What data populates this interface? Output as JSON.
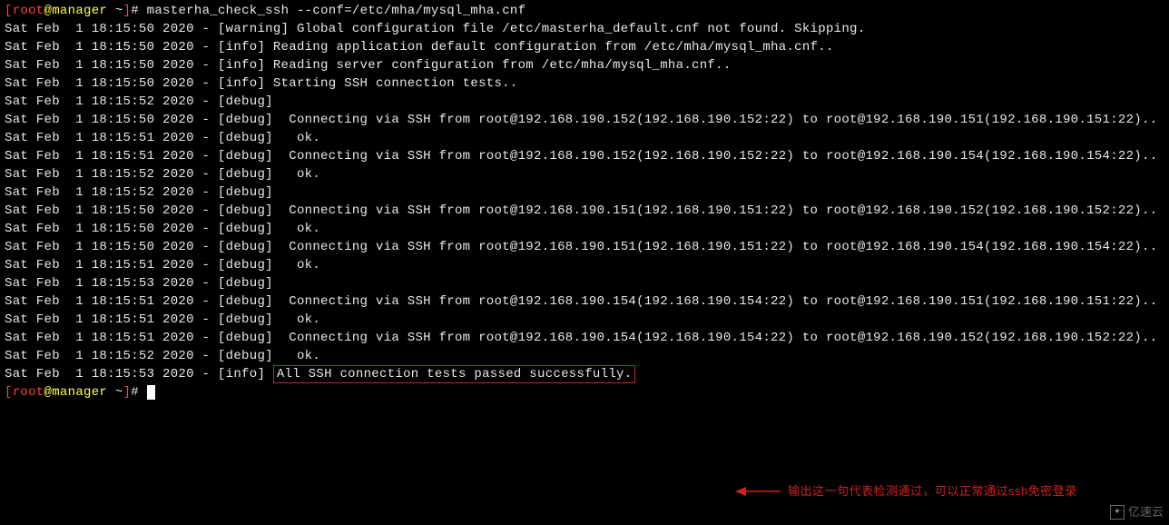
{
  "prompt1": {
    "bracket_open": "[",
    "user": "root",
    "at": "@",
    "host": "manager",
    "path": " ~",
    "bracket_close": "]",
    "hash": "# ",
    "cmd": "masterha_check_ssh --conf=/etc/mha/mysql_mha.cnf"
  },
  "lines": [
    "Sat Feb  1 18:15:50 2020 - [warning] Global configuration file /etc/masterha_default.cnf not found. Skipping.",
    "Sat Feb  1 18:15:50 2020 - [info] Reading application default configuration from /etc/mha/mysql_mha.cnf..",
    "Sat Feb  1 18:15:50 2020 - [info] Reading server configuration from /etc/mha/mysql_mha.cnf..",
    "Sat Feb  1 18:15:50 2020 - [info] Starting SSH connection tests..",
    "Sat Feb  1 18:15:52 2020 - [debug] ",
    "Sat Feb  1 18:15:50 2020 - [debug]  Connecting via SSH from root@192.168.190.152(192.168.190.152:22) to root@192.168.190.151(192.168.190.151:22)..",
    "Sat Feb  1 18:15:51 2020 - [debug]   ok.",
    "Sat Feb  1 18:15:51 2020 - [debug]  Connecting via SSH from root@192.168.190.152(192.168.190.152:22) to root@192.168.190.154(192.168.190.154:22)..",
    "Sat Feb  1 18:15:52 2020 - [debug]   ok.",
    "Sat Feb  1 18:15:52 2020 - [debug] ",
    "Sat Feb  1 18:15:50 2020 - [debug]  Connecting via SSH from root@192.168.190.151(192.168.190.151:22) to root@192.168.190.152(192.168.190.152:22)..",
    "Sat Feb  1 18:15:50 2020 - [debug]   ok.",
    "Sat Feb  1 18:15:50 2020 - [debug]  Connecting via SSH from root@192.168.190.151(192.168.190.151:22) to root@192.168.190.154(192.168.190.154:22)..",
    "Sat Feb  1 18:15:51 2020 - [debug]   ok.",
    "Sat Feb  1 18:15:53 2020 - [debug] ",
    "Sat Feb  1 18:15:51 2020 - [debug]  Connecting via SSH from root@192.168.190.154(192.168.190.154:22) to root@192.168.190.151(192.168.190.151:22)..",
    "Sat Feb  1 18:15:51 2020 - [debug]   ok.",
    "Sat Feb  1 18:15:51 2020 - [debug]  Connecting via SSH from root@192.168.190.154(192.168.190.154:22) to root@192.168.190.152(192.168.190.152:22)..",
    "Sat Feb  1 18:15:52 2020 - [debug]   ok."
  ],
  "final_line_prefix": "Sat Feb  1 18:15:53 2020 - [info] ",
  "final_line_boxed": "All SSH connection tests passed successfully.",
  "prompt2": {
    "bracket_open": "[",
    "user": "root",
    "at": "@",
    "host": "manager",
    "path": " ~",
    "bracket_close": "]",
    "hash": "# "
  },
  "annotation": "输出这一句代表检测通过，可以正常通过ssh免密登录",
  "watermark_text": "亿速云"
}
